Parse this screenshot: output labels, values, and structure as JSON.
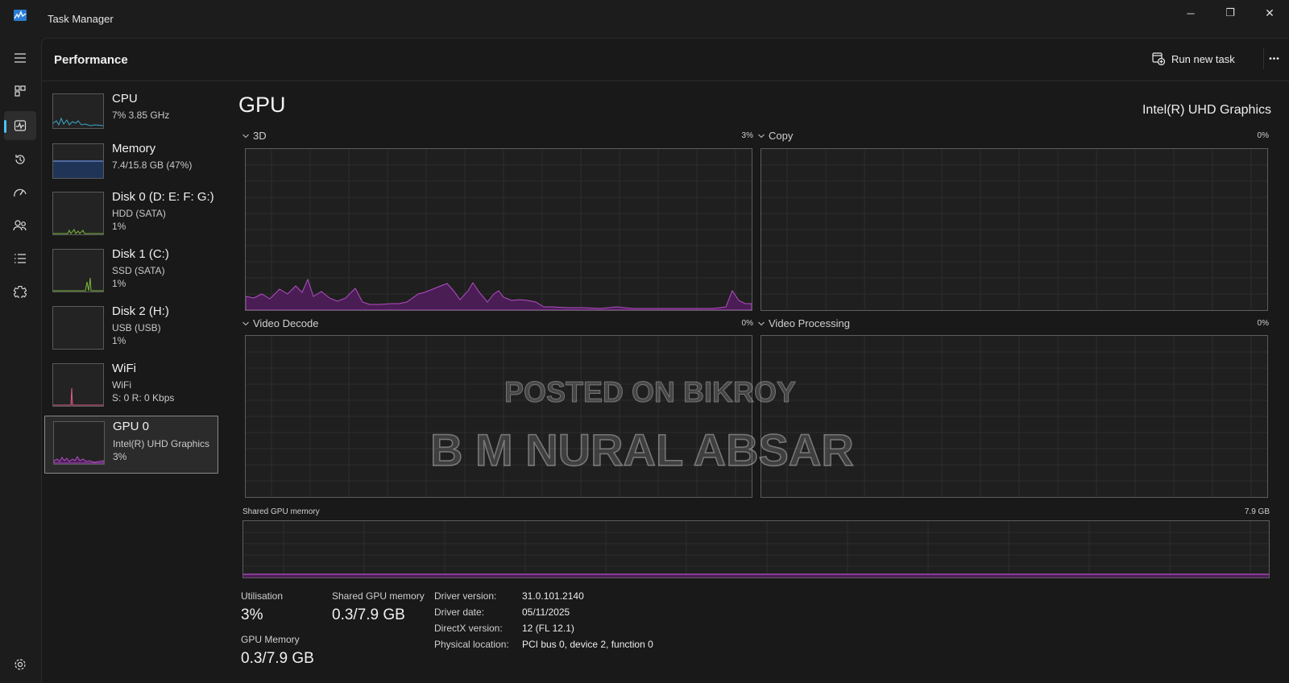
{
  "window": {
    "title": "Task Manager",
    "minimize_glyph": "─",
    "maximize_glyph": "❐",
    "close_glyph": "✕"
  },
  "header": {
    "title": "Performance",
    "run_new_task": "Run new task",
    "more_glyph": "•••"
  },
  "nav_rail": [
    "hamburger-icon",
    "processes-icon",
    "performance-icon",
    "app-history-icon",
    "startup-apps-icon",
    "users-icon",
    "details-icon",
    "services-icon",
    "settings-icon"
  ],
  "devices": [
    {
      "name": "CPU",
      "sub1": "7%  3.85 GHz",
      "sub2": "",
      "color": "#3aa7c7"
    },
    {
      "name": "Memory",
      "sub1": "7.4/15.8 GB (47%)",
      "sub2": "",
      "color": "#6a8fd8"
    },
    {
      "name": "Disk 0 (D: E: F: G:)",
      "sub1": "HDD (SATA)",
      "sub2": "1%",
      "color": "#7bb83b"
    },
    {
      "name": "Disk 1 (C:)",
      "sub1": "SSD (SATA)",
      "sub2": "1%",
      "color": "#7bb83b"
    },
    {
      "name": "Disk 2 (H:)",
      "sub1": "USB (USB)",
      "sub2": "1%",
      "color": "#7bb83b"
    },
    {
      "name": "WiFi",
      "sub1": "WiFi",
      "sub2": "S: 0 R: 0 Kbps",
      "color": "#d8608a"
    },
    {
      "name": "GPU 0",
      "sub1": "Intel(R) UHD Graphics",
      "sub2": "3%",
      "color": "#b34fc4"
    }
  ],
  "gpu": {
    "title": "GPU",
    "model": "Intel(R) UHD Graphics",
    "engines": [
      {
        "label": "3D",
        "pct": "3%"
      },
      {
        "label": "Copy",
        "pct": "0%"
      },
      {
        "label": "Video Decode",
        "pct": "0%"
      },
      {
        "label": "Video Processing",
        "pct": "0%"
      }
    ],
    "shared_memory_label": "Shared GPU memory",
    "shared_memory_max": "7.9 GB",
    "stats": {
      "utilisation_label": "Utilisation",
      "utilisation_value": "3%",
      "shared_label": "Shared GPU memory",
      "shared_value": "0.3/7.9 GB",
      "gpu_memory_label": "GPU Memory",
      "gpu_memory_value": "0.3/7.9 GB"
    },
    "details": [
      {
        "key": "Driver version:",
        "value": "31.0.101.2140"
      },
      {
        "key": "Driver date:",
        "value": "05/11/2025"
      },
      {
        "key": "DirectX version:",
        "value": "12 (FL 12.1)"
      },
      {
        "key": "Physical location:",
        "value": "PCI bus 0, device 2, function 0"
      }
    ]
  },
  "watermark": {
    "line1": "POSTED ON BIKROY",
    "line2": "B M NURAL ABSAR"
  },
  "colors": {
    "gpu_line": "#b34fc4",
    "gpu_fill": "#4a1d55",
    "accent": "#4cc2ff"
  }
}
